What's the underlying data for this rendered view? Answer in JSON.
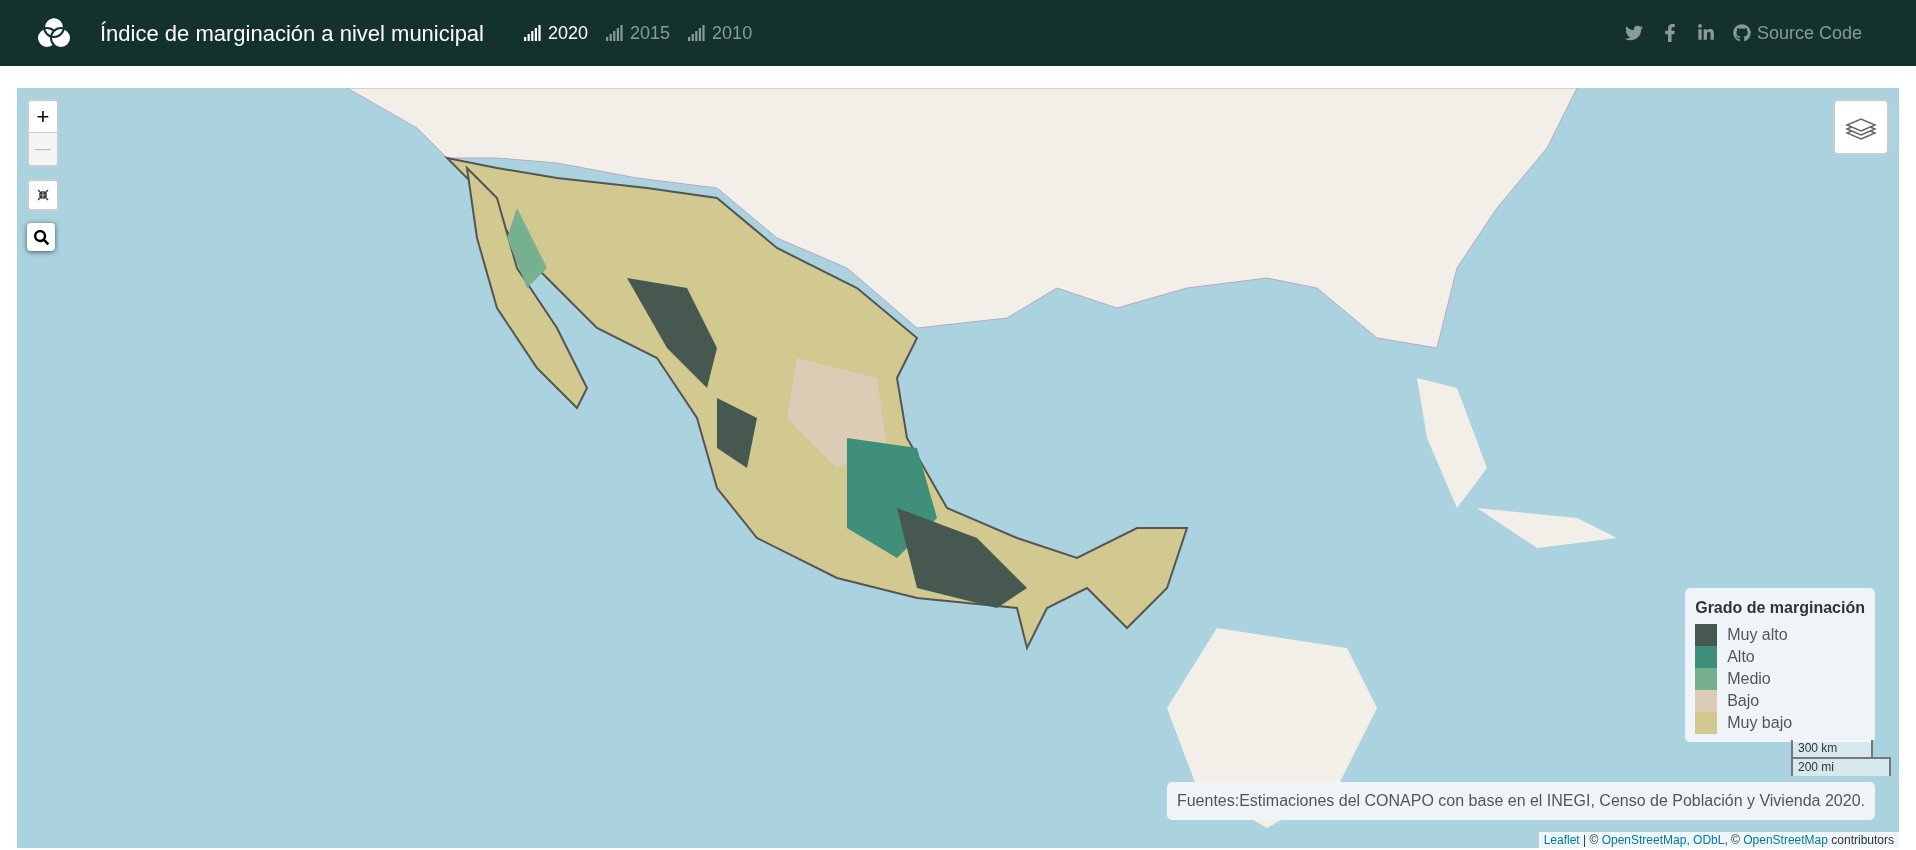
{
  "header": {
    "title": "Índice de marginación a nivel municipal",
    "years": [
      {
        "label": "2020",
        "selected": true
      },
      {
        "label": "2015",
        "selected": false
      },
      {
        "label": "2010",
        "selected": false
      }
    ],
    "social": [
      {
        "kind": "twitter"
      },
      {
        "kind": "facebook"
      },
      {
        "kind": "linkedin"
      }
    ],
    "source_link": "Source Code"
  },
  "map": {
    "zoom_in": "+",
    "zoom_out": "—",
    "zoom_out_disabled": true,
    "legend": {
      "title": "Grado de marginación",
      "items": [
        {
          "label": "Muy alto",
          "color": "#46584f"
        },
        {
          "label": "Alto",
          "color": "#3f8f7b"
        },
        {
          "label": "Medio",
          "color": "#76b08f"
        },
        {
          "label": "Bajo",
          "color": "#dccbb5"
        },
        {
          "label": "Muy bajo",
          "color": "#d1c98f"
        }
      ]
    },
    "scale": [
      "300 km",
      "200 mi"
    ],
    "source_note": "Fuentes:Estimaciones del CONAPO con base en el INEGI, Censo de Población y Vivienda 2020.",
    "attribution": [
      {
        "kind": "link",
        "text": "Leaflet"
      },
      {
        "kind": "text",
        "text": " | © "
      },
      {
        "kind": "link",
        "text": "OpenStreetMap, ODbL"
      },
      {
        "kind": "text",
        "text": ", © "
      },
      {
        "kind": "link",
        "text": "OpenStreetMap"
      },
      {
        "kind": "text",
        "text": " contributors"
      }
    ]
  }
}
